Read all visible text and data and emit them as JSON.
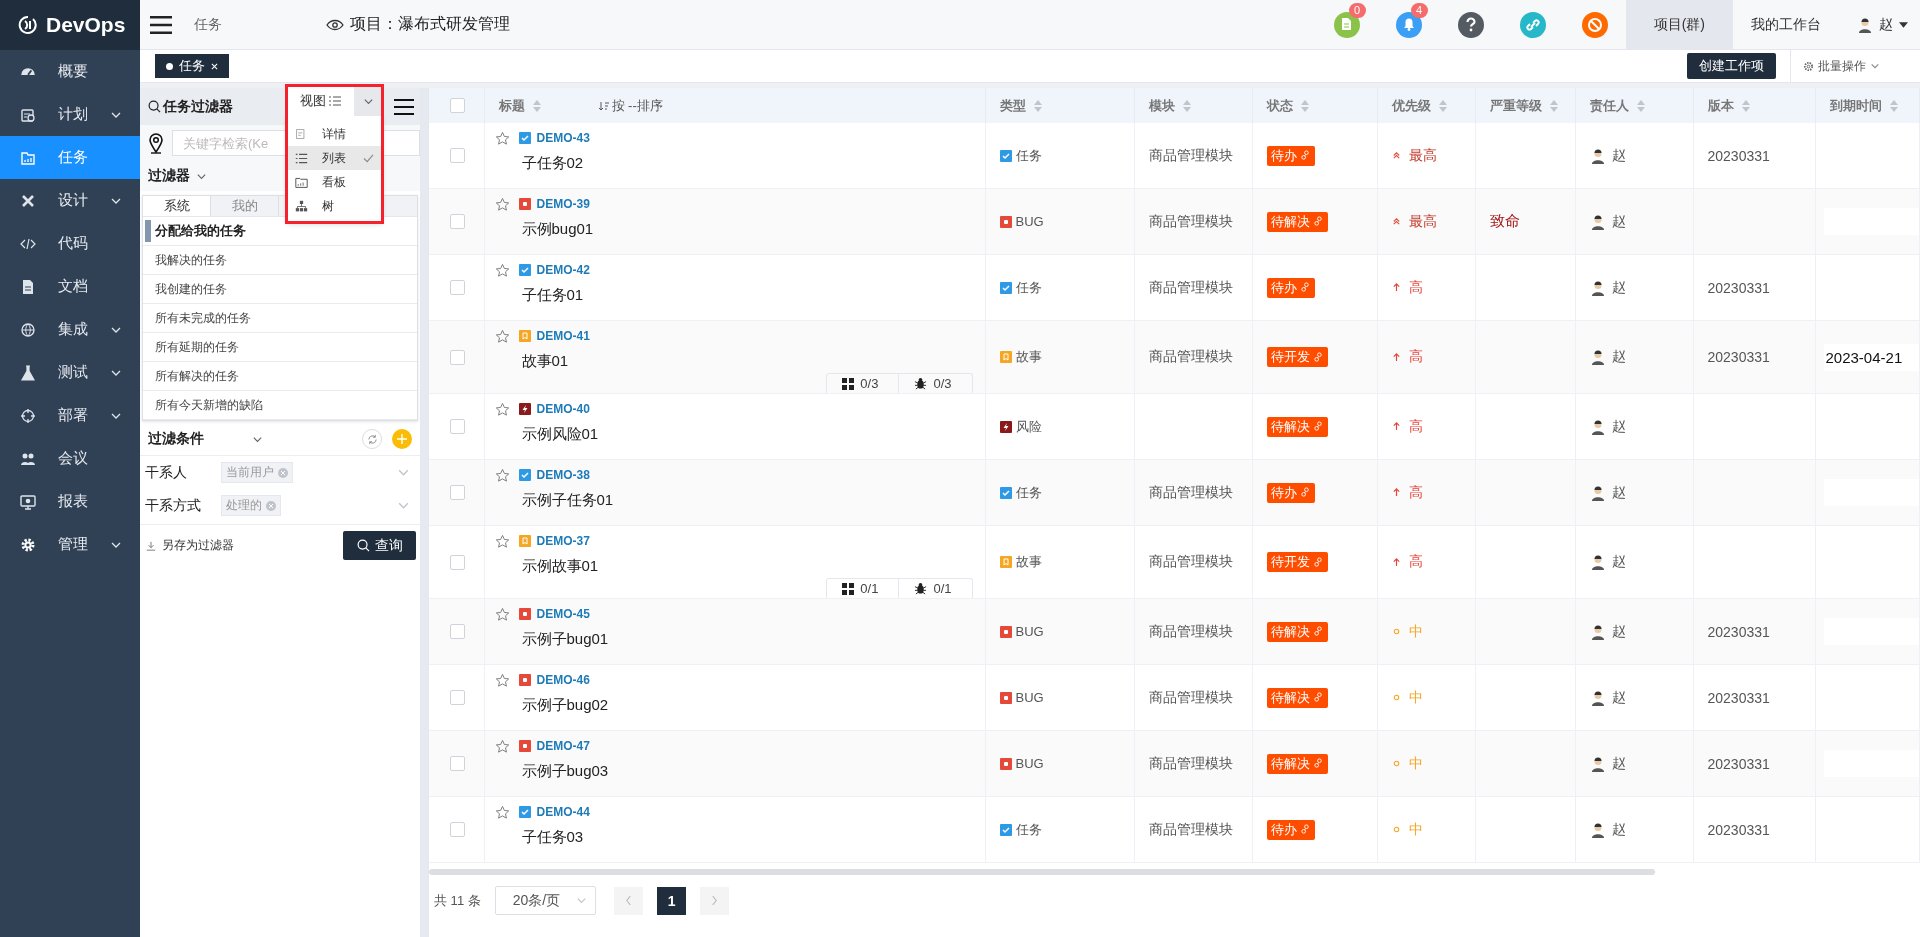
{
  "sidebar": {
    "logo": "DevOps",
    "items": [
      {
        "label": "概要",
        "kind": "dashboard",
        "collapsible": false,
        "selected": false
      },
      {
        "label": "计划",
        "kind": "plan",
        "collapsible": true,
        "selected": false
      },
      {
        "label": "任务",
        "kind": "task",
        "collapsible": false,
        "selected": true
      },
      {
        "label": "设计",
        "kind": "design",
        "collapsible": true,
        "selected": false
      },
      {
        "label": "代码",
        "kind": "code",
        "collapsible": false,
        "selected": false
      },
      {
        "label": "文档",
        "kind": "doc",
        "collapsible": false,
        "selected": false
      },
      {
        "label": "集成",
        "kind": "integration",
        "collapsible": true,
        "selected": false
      },
      {
        "label": "测试",
        "kind": "test",
        "collapsible": true,
        "selected": false
      },
      {
        "label": "部署",
        "kind": "deploy",
        "collapsible": true,
        "selected": false
      },
      {
        "label": "会议",
        "kind": "meeting",
        "collapsible": false,
        "selected": false
      },
      {
        "label": "报表",
        "kind": "report",
        "collapsible": false,
        "selected": false
      },
      {
        "label": "管理",
        "kind": "manage",
        "collapsible": true,
        "selected": false
      }
    ]
  },
  "topbar": {
    "breadcrumb": "任务",
    "project": "项目：瀑布式研发管理",
    "notices": [
      {
        "kind": "doc",
        "badge": "0"
      },
      {
        "kind": "bell",
        "badge": "4"
      },
      {
        "kind": "help"
      },
      {
        "kind": "link"
      },
      {
        "kind": "block"
      }
    ],
    "nav": [
      {
        "label": "项目(群)",
        "selected": true
      },
      {
        "label": "我的工作台",
        "selected": false
      }
    ],
    "user": "赵"
  },
  "open_tabs": [
    {
      "label": "任务",
      "selected": true
    }
  ],
  "actions": {
    "create": "创建工作项",
    "batch": "批量操作"
  },
  "filter_panel": {
    "title": "任务过滤器",
    "view_menu": {
      "label": "视图",
      "highlighted": true,
      "items": [
        {
          "label": "详情",
          "kind": "detail",
          "selected": false
        },
        {
          "label": "列表",
          "kind": "list",
          "selected": true
        },
        {
          "label": "看板",
          "kind": "board",
          "selected": false
        },
        {
          "label": "树",
          "kind": "tree",
          "selected": false
        }
      ]
    },
    "search": {
      "placeholder": "关键字检索(Ke"
    },
    "filters_heading": "过滤器",
    "tabs": [
      {
        "label": "系统",
        "selected": true
      },
      {
        "label": "我的",
        "selected": false
      }
    ],
    "filters": [
      {
        "label": "分配给我的任务",
        "selected": true
      },
      {
        "label": "我解决的任务",
        "selected": false
      },
      {
        "label": "我创建的任务",
        "selected": false
      },
      {
        "label": "所有未完成的任务",
        "selected": false
      },
      {
        "label": "所有延期的任务",
        "selected": false
      },
      {
        "label": "所有解决的任务",
        "selected": false
      },
      {
        "label": "所有今天新增的缺陷",
        "selected": false
      }
    ],
    "conditions_heading": "过滤条件",
    "conditions": [
      {
        "label": "干系人",
        "value": "当前用户"
      },
      {
        "label": "干系方式",
        "value": "处理的"
      }
    ],
    "save_link": "另存为过滤器",
    "query_button": "查询"
  },
  "table": {
    "all_checked": false,
    "columns": [
      {
        "label": "标题"
      },
      {
        "label": "类型"
      },
      {
        "label": "模块"
      },
      {
        "label": "状态"
      },
      {
        "label": "优先级"
      },
      {
        "label": "严重等级"
      },
      {
        "label": "责任人"
      },
      {
        "label": "版本"
      },
      {
        "label": "到期时间"
      }
    ],
    "sort_hint": "按 --排序",
    "rows": [
      {
        "checked": false,
        "starred": false,
        "id": "DEMO-43",
        "type": {
          "kind": "task",
          "label": "任务"
        },
        "title": "子任务02",
        "module": "商品管理模块",
        "status": "待办",
        "priority": {
          "kind": "highest",
          "label": "最高"
        },
        "assignee": "赵",
        "version": "20230331",
        "due_field": false
      },
      {
        "checked": false,
        "starred": false,
        "id": "DEMO-39",
        "type": {
          "kind": "bug",
          "label": "BUG"
        },
        "title": "示例bug01",
        "module": "商品管理模块",
        "status": "待解决",
        "priority": {
          "kind": "highest",
          "label": "最高"
        },
        "severity": "致命",
        "assignee": "赵",
        "due_field": true
      },
      {
        "checked": false,
        "starred": false,
        "id": "DEMO-42",
        "type": {
          "kind": "task",
          "label": "任务"
        },
        "title": "子任务01",
        "module": "商品管理模块",
        "status": "待办",
        "priority": {
          "kind": "high",
          "label": "高"
        },
        "assignee": "赵",
        "version": "20230331",
        "due_field": false
      },
      {
        "checked": false,
        "starred": false,
        "id": "DEMO-41",
        "type": {
          "kind": "story",
          "label": "故事"
        },
        "title": "故事01",
        "module": "商品管理模块",
        "status": "待开发",
        "priority": {
          "kind": "high",
          "label": "高"
        },
        "assignee": "赵",
        "version": "20230331",
        "due_field": true,
        "due": "2023-04-21",
        "counts": [
          {
            "kind": "subtask",
            "text": "0/3"
          },
          {
            "kind": "bug",
            "text": "0/3"
          }
        ]
      },
      {
        "checked": false,
        "starred": false,
        "id": "DEMO-40",
        "type": {
          "kind": "risk",
          "label": "风险"
        },
        "title": "示例风险01",
        "status": "待解决",
        "priority": {
          "kind": "high",
          "label": "高"
        },
        "assignee": "赵",
        "due_field": false
      },
      {
        "checked": false,
        "starred": false,
        "id": "DEMO-38",
        "type": {
          "kind": "task",
          "label": "任务"
        },
        "title": "示例子任务01",
        "module": "商品管理模块",
        "status": "待办",
        "priority": {
          "kind": "high",
          "label": "高"
        },
        "assignee": "赵",
        "due_field": true
      },
      {
        "checked": false,
        "starred": false,
        "id": "DEMO-37",
        "type": {
          "kind": "story",
          "label": "故事"
        },
        "title": "示例故事01",
        "module": "商品管理模块",
        "status": "待开发",
        "priority": {
          "kind": "high",
          "label": "高"
        },
        "assignee": "赵",
        "due_field": false,
        "counts": [
          {
            "kind": "subtask",
            "text": "0/1"
          },
          {
            "kind": "bug",
            "text": "0/1"
          }
        ]
      },
      {
        "checked": false,
        "starred": false,
        "id": "DEMO-45",
        "type": {
          "kind": "bug",
          "label": "BUG"
        },
        "title": "示例子bug01",
        "module": "商品管理模块",
        "status": "待解决",
        "priority": {
          "kind": "medium",
          "label": "中"
        },
        "assignee": "赵",
        "version": "20230331",
        "due_field": true
      },
      {
        "checked": false,
        "starred": false,
        "id": "DEMO-46",
        "type": {
          "kind": "bug",
          "label": "BUG"
        },
        "title": "示例子bug02",
        "module": "商品管理模块",
        "status": "待解决",
        "priority": {
          "kind": "medium",
          "label": "中"
        },
        "assignee": "赵",
        "version": "20230331",
        "due_field": false
      },
      {
        "checked": false,
        "starred": false,
        "id": "DEMO-47",
        "type": {
          "kind": "bug",
          "label": "BUG"
        },
        "title": "示例子bug03",
        "module": "商品管理模块",
        "status": "待解决",
        "priority": {
          "kind": "medium",
          "label": "中"
        },
        "assignee": "赵",
        "version": "20230331",
        "due_field": true
      },
      {
        "checked": false,
        "starred": false,
        "id": "DEMO-44",
        "type": {
          "kind": "task",
          "label": "任务"
        },
        "title": "子任务03",
        "module": "商品管理模块",
        "status": "待办",
        "priority": {
          "kind": "medium",
          "label": "中"
        },
        "assignee": "赵",
        "version": "20230331",
        "due_field": false
      }
    ]
  },
  "pager": {
    "total": "共 11 条",
    "page_size": "20条/页",
    "pages": [
      {
        "label": "1",
        "selected": true
      }
    ]
  }
}
